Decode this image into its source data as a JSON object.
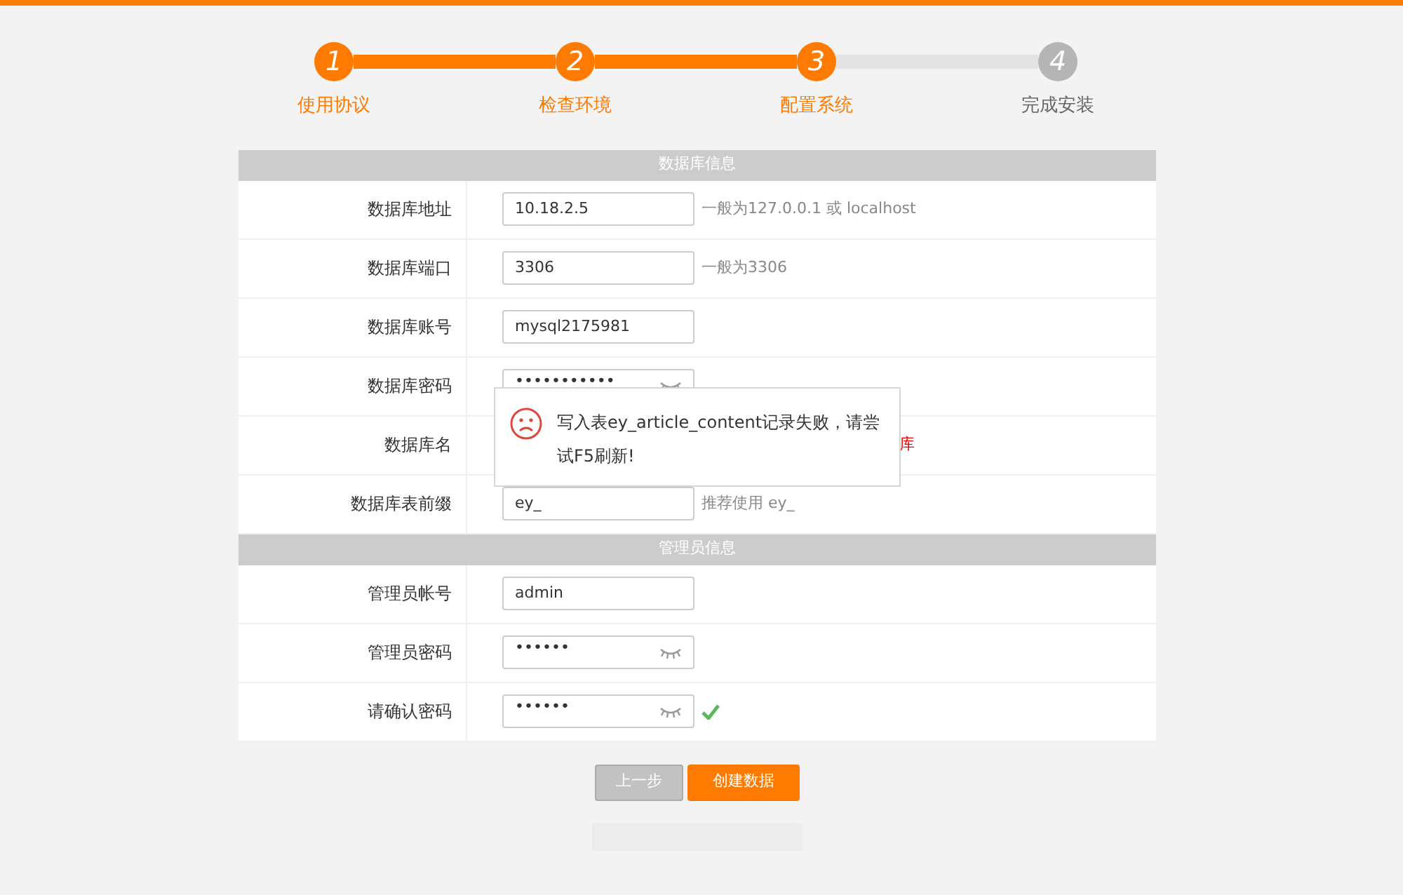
{
  "steps": [
    {
      "number": "1",
      "label": "使用协议",
      "reached": true
    },
    {
      "number": "2",
      "label": "检查环境",
      "reached": true
    },
    {
      "number": "3",
      "label": "配置系统",
      "reached": true
    },
    {
      "number": "4",
      "label": "完成安装",
      "reached": false
    }
  ],
  "sections": [
    {
      "title": "数据库信息",
      "rows": [
        {
          "label": "数据库地址",
          "kind": "text",
          "value": "10.18.2.5",
          "hint": "一般为127.0.0.1 或 localhost",
          "error": false
        },
        {
          "label": "数据库端口",
          "kind": "text",
          "value": "3306",
          "hint": "一般为3306",
          "error": false
        },
        {
          "label": "数据库账号",
          "kind": "text",
          "value": "mysql2175981"
        },
        {
          "label": "数据库密码",
          "kind": "password",
          "value": "•••••••••••"
        },
        {
          "label": "数据库名",
          "kind": "hidden",
          "hint": "库",
          "error": true
        },
        {
          "label": "数据库表前缀",
          "kind": "text",
          "value": "ey_",
          "hint": "推荐使用 ey_",
          "error": false
        }
      ]
    },
    {
      "title": "管理员信息",
      "rows": [
        {
          "label": "管理员帐号",
          "kind": "text",
          "value": "admin"
        },
        {
          "label": "管理员密码",
          "kind": "password",
          "value": "••••••"
        },
        {
          "label": "请确认密码",
          "kind": "password",
          "value": "••••••",
          "check": true
        }
      ]
    }
  ],
  "buttons": [
    {
      "label": "上一步",
      "kind": "secondary"
    },
    {
      "label": "创建数据",
      "kind": "primary"
    }
  ],
  "dialog": {
    "message": "写入表ey_article_content记录失败，请尝试F5刷新!"
  }
}
